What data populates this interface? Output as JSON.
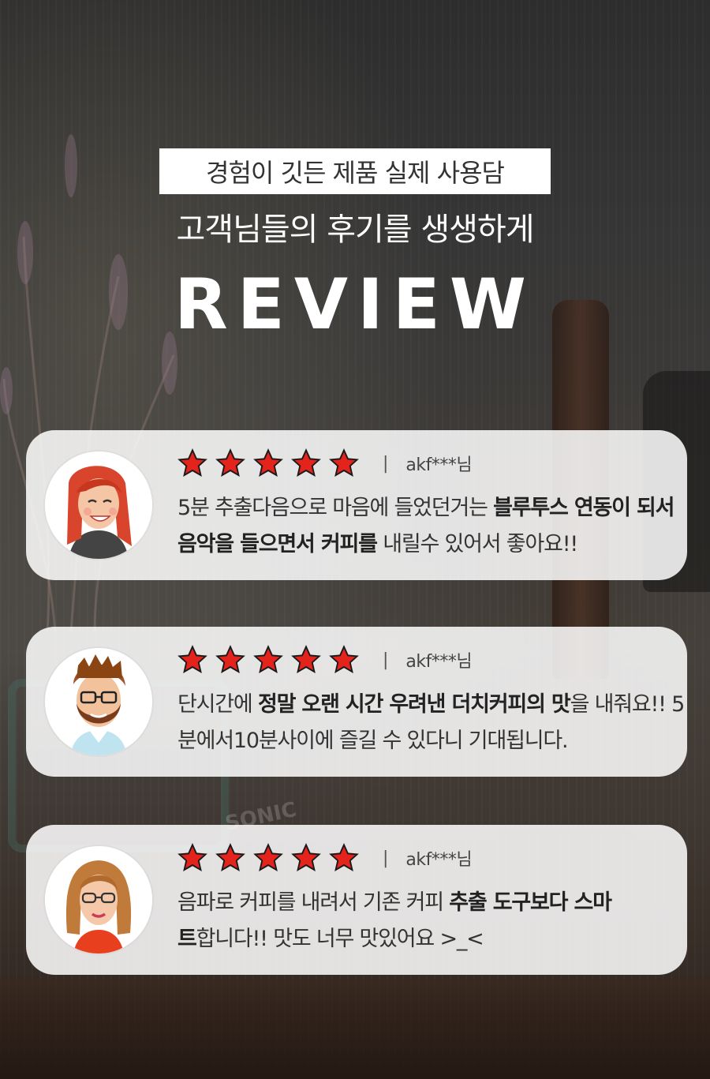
{
  "header": {
    "subtitle": "경험이 깃든 제품 실제 사용담",
    "tagline": "고객님들의 후기를 생생하게",
    "title": "REVIEW"
  },
  "background": {
    "device_label": "SONIC"
  },
  "colors": {
    "star": "#e3231c",
    "star_outline": "#1a1a1a",
    "card_bg": "rgba(255,255,255,0.86)"
  },
  "reviews": [
    {
      "avatar": "woman-red-hair-avatar",
      "rating": 5,
      "separator": "|",
      "user": "akf***님",
      "text": [
        {
          "t": "5분 추출다음으로 마음에 들었던거는 ",
          "bold": false
        },
        {
          "t": "블루투스 연동이 되서 음악을 들으면서 커피를",
          "bold": true
        },
        {
          "t": " 내릴수 있어서 좋아요!!",
          "bold": false
        }
      ]
    },
    {
      "avatar": "bearded-man-glasses-avatar",
      "rating": 5,
      "separator": "|",
      "user": "akf***님",
      "text": [
        {
          "t": "단시간에 ",
          "bold": false
        },
        {
          "t": "정말 오랜 시간 우려낸 더치커피의 맛",
          "bold": true
        },
        {
          "t": "을 내줘요!! 5분에서10분사이에 즐길 수 있다니 기대됩니다.",
          "bold": false
        }
      ]
    },
    {
      "avatar": "woman-glasses-avatar",
      "rating": 5,
      "separator": "|",
      "user": "akf***님",
      "text": [
        {
          "t": "음파로 커피를 내려서 기존 커피 ",
          "bold": false
        },
        {
          "t": "추출 도구보다 스마트",
          "bold": true
        },
        {
          "t": "합니다!! 맛도 너무 맛있어요 >_<",
          "bold": false
        }
      ]
    }
  ]
}
